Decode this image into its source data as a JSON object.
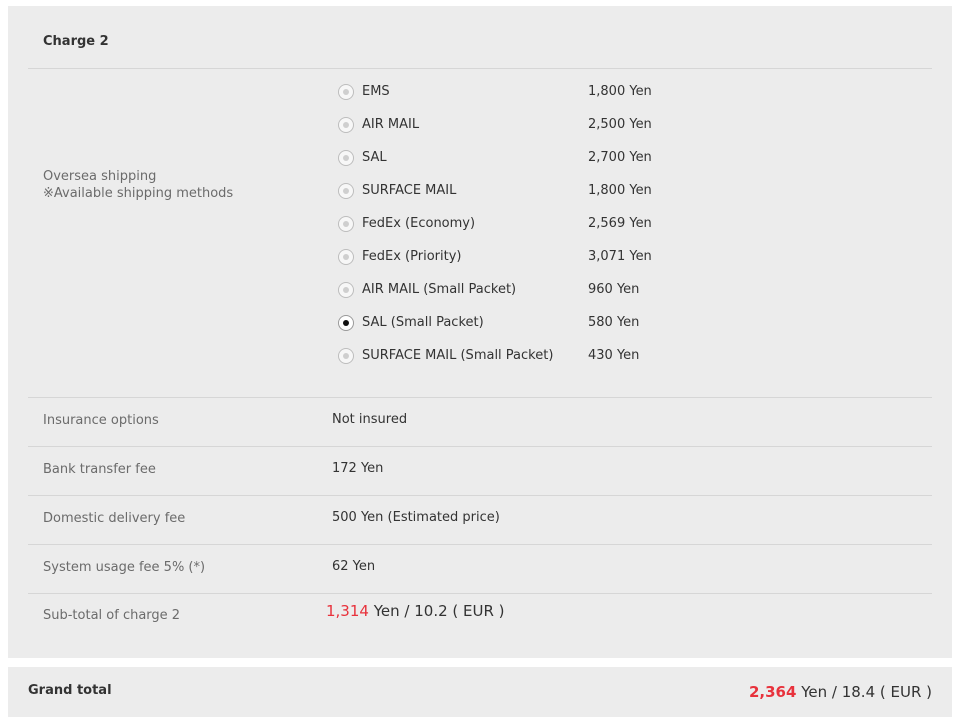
{
  "charge": {
    "title": "Charge 2",
    "oversea_label_line1": "Oversea shipping",
    "oversea_label_line2": "※Available shipping methods",
    "shipping_options": [
      {
        "name": "EMS",
        "price": "1,800 Yen",
        "selected": false
      },
      {
        "name": "AIR MAIL",
        "price": "2,500 Yen",
        "selected": false
      },
      {
        "name": "SAL",
        "price": "2,700 Yen",
        "selected": false
      },
      {
        "name": "SURFACE MAIL",
        "price": "1,800 Yen",
        "selected": false
      },
      {
        "name": "FedEx (Economy)",
        "price": "2,569 Yen",
        "selected": false
      },
      {
        "name": "FedEx (Priority)",
        "price": "3,071 Yen",
        "selected": false
      },
      {
        "name": "AIR MAIL (Small Packet)",
        "price": "960 Yen",
        "selected": false
      },
      {
        "name": "SAL (Small Packet)",
        "price": "580 Yen",
        "selected": true
      },
      {
        "name": "SURFACE MAIL (Small Packet)",
        "price": "430 Yen",
        "selected": false
      }
    ],
    "insurance": {
      "label": "Insurance options",
      "value": "Not insured"
    },
    "bank_fee": {
      "label": "Bank transfer fee",
      "value": "172 Yen"
    },
    "domestic_fee": {
      "label": "Domestic delivery fee",
      "value": "500 Yen (Estimated price)"
    },
    "system_fee": {
      "label": "System usage fee 5% (*)",
      "value": "62 Yen"
    },
    "subtotal": {
      "label": "Sub-total of charge 2",
      "amount": "1,314",
      "unit": "Yen",
      "converted": "/ 10.2 ( EUR )"
    }
  },
  "grand_total": {
    "label": "Grand total",
    "amount": "2,364",
    "unit": "Yen",
    "converted": "/ 18.4 ( EUR )"
  },
  "colors": {
    "accent_red": "#e8323c",
    "panel_bg": "#ececec"
  }
}
